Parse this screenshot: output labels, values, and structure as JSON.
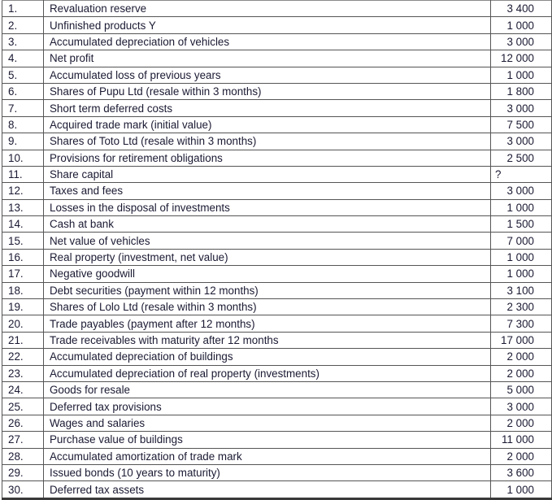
{
  "table": {
    "rows": [
      {
        "no": "1.",
        "item": "Revaluation reserve",
        "value": "3 400"
      },
      {
        "no": "2.",
        "item": "Unfinished products Y",
        "value": "1 000"
      },
      {
        "no": "3.",
        "item": "Accumulated depreciation of vehicles",
        "value": "3 000"
      },
      {
        "no": "4.",
        "item": "Net profit",
        "value": "12 000"
      },
      {
        "no": "5.",
        "item": "Accumulated loss of previous years",
        "value": "1 000"
      },
      {
        "no": "6.",
        "item": "Shares of Pupu Ltd (resale within 3 months)",
        "value": "1 800"
      },
      {
        "no": "7.",
        "item": "Short term deferred costs",
        "value": "3 000"
      },
      {
        "no": "8.",
        "item": "Acquired trade mark (initial value)",
        "value": "7 500"
      },
      {
        "no": "9.",
        "item": "Shares of Toto Ltd (resale within 3 months)",
        "value": "3 000"
      },
      {
        "no": "10.",
        "item": "Provisions for retirement obligations",
        "value": "2 500"
      },
      {
        "no": "11.",
        "item": "Share capital",
        "value": "?"
      },
      {
        "no": "12.",
        "item": "Taxes and fees",
        "value": "3 000"
      },
      {
        "no": "13.",
        "item": "Losses in the disposal of investments",
        "value": "1 000"
      },
      {
        "no": "14.",
        "item": "Cash at bank",
        "value": "1 500"
      },
      {
        "no": "15.",
        "item": "Net value of vehicles",
        "value": "7 000"
      },
      {
        "no": "16.",
        "item": "Real property (investment, net value)",
        "value": "1 000"
      },
      {
        "no": "17.",
        "item": "Negative goodwill",
        "value": "1 000"
      },
      {
        "no": "18.",
        "item": "Debt securities (payment within 12 months)",
        "value": "3 100"
      },
      {
        "no": "19.",
        "item": "Shares of Lolo Ltd (resale within 3 months)",
        "value": "2 300"
      },
      {
        "no": "20.",
        "item": "Trade payables (payment after 12 months)",
        "value": "7 300"
      },
      {
        "no": "21.",
        "item": "Trade receivables with maturity after 12 months",
        "value": "17 000"
      },
      {
        "no": "22.",
        "item": "Accumulated depreciation of buildings",
        "value": "2 000"
      },
      {
        "no": "23.",
        "item": "Accumulated depreciation of real property (investments)",
        "value": "2 000"
      },
      {
        "no": "24.",
        "item": "Goods for resale",
        "value": "5 000"
      },
      {
        "no": "25.",
        "item": "Deferred tax provisions",
        "value": "3 000"
      },
      {
        "no": "26.",
        "item": "Wages and salaries",
        "value": "2 000"
      },
      {
        "no": "27.",
        "item": "Purchase value of buildings",
        "value": "11 000"
      },
      {
        "no": "28.",
        "item": "Accumulated amortization of trade mark",
        "value": "2 000"
      },
      {
        "no": "29.",
        "item": "Issued bonds (10 years to maturity)",
        "value": "3 600"
      },
      {
        "no": "30.",
        "item": "Deferred tax assets",
        "value": "1 000"
      }
    ]
  }
}
